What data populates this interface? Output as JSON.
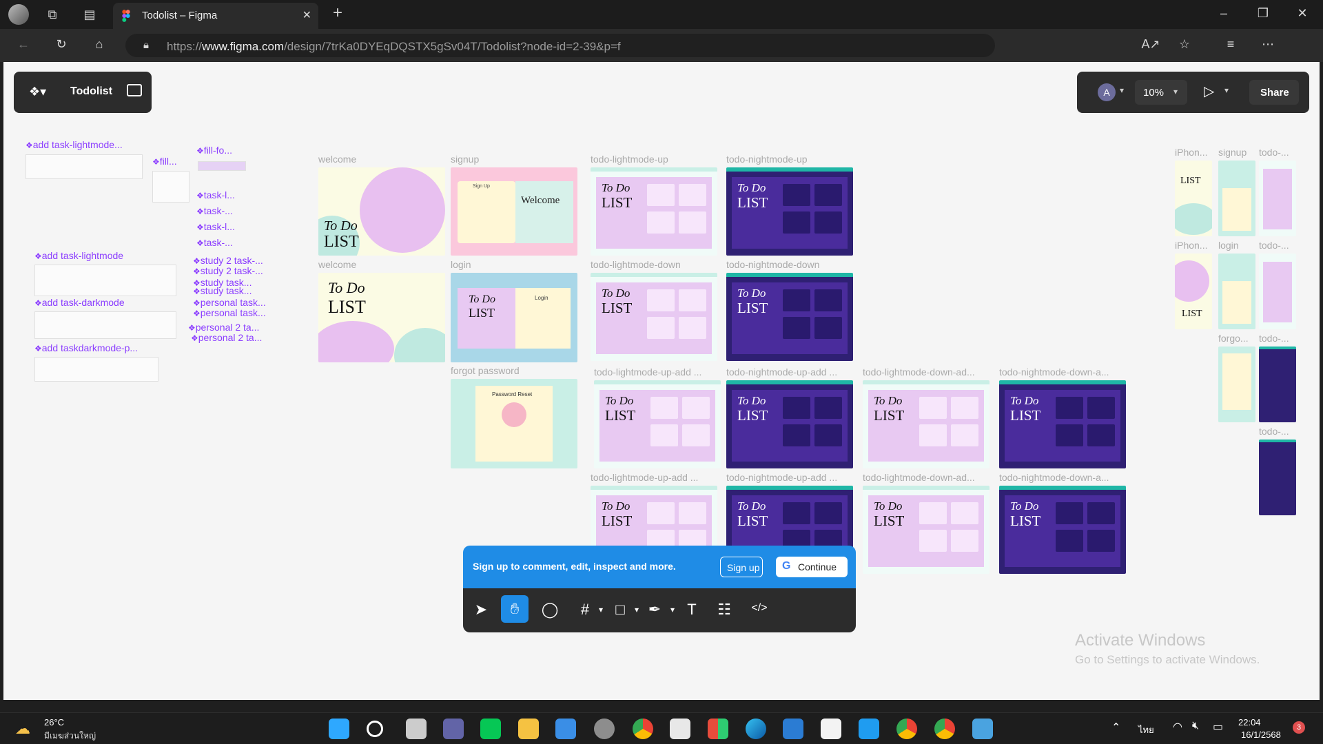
{
  "browser": {
    "tab_title": "Todolist – Figma",
    "url_prefix": "https://",
    "url_host": "www.figma.com",
    "url_path": "/design/7trKa0DYEqDQSTX5gSv04T/Todolist?node-id=2-39&p=f",
    "icons": {
      "back": "arrow-left-icon",
      "reload": "reload-icon",
      "home": "home-icon",
      "lock": "lock-icon",
      "read_aloud": "read-aloud-icon",
      "favorite": "star-icon",
      "favorites_list": "favorites-icon",
      "more": "more-icon",
      "copilot": "copilot-icon",
      "new_tab": "plus-icon"
    }
  },
  "figma": {
    "file_name": "Todolist",
    "avatar_letter": "A",
    "zoom": "10%",
    "share_label": "Share",
    "accent": "#1f8ce6"
  },
  "canvas": {
    "component_labels": [
      "add task-lightmode...",
      "fill...",
      "fill-fo...",
      "task-l...",
      "task-...",
      "task-l...",
      "task-...",
      "add task-lightmode",
      "study 2 task-...",
      "study 2 task-...",
      "study task...",
      "study task...",
      "add task-darkmode",
      "personal task...",
      "personal task...",
      "add taskdarkmode-p...",
      "personal 2 ta...",
      "personal 2 ta..."
    ],
    "frames": {
      "welcome": "welcome",
      "welcome2": "welcome",
      "signup": "signup",
      "login": "login",
      "forgot": "forgot password",
      "light_up": "todo-lightmode-up",
      "night_up": "todo-nightmode-up",
      "light_down": "todo-lightmode-down",
      "night_down": "todo-nightmode-down",
      "light_up_add": "todo-lightmode-up-add ...",
      "night_up_add": "todo-nightmode-up-add ...",
      "light_down_add": "todo-lightmode-down-ad...",
      "night_down_add": "todo-nightmode-down-a...",
      "light_up_add2": "todo-lightmode-up-add ...",
      "night_up_add2": "todo-nightmode-up-add ...",
      "light_down_add2": "todo-lightmode-down-ad...",
      "night_down_add2": "todo-nightmode-down-a...",
      "iphone1": "iPhon...",
      "iphone2": "iPhon...",
      "signup_m": "signup",
      "login_m": "login",
      "forgot_m": "forgo...",
      "todo_m1": "todo-...",
      "todo_m2": "todo-...",
      "todo_m3": "todo-...",
      "todo_m4": "todo-..."
    },
    "thumb_text": {
      "to_do": "To Do",
      "list": "LIST",
      "welcome": "Welcome",
      "sign_up": "Sign Up",
      "login": "Login",
      "password_reset": "Password Reset"
    }
  },
  "signup_banner": {
    "message": "Sign up to comment, edit, inspect and more.",
    "signup": "Sign up",
    "continue": "Continue"
  },
  "toolbar": {
    "icons": [
      "move-icon",
      "hand-icon",
      "comment-icon",
      "frame-icon",
      "rectangle-icon",
      "pen-icon",
      "text-icon",
      "components-icon",
      "dev-mode-icon"
    ]
  },
  "watermark": {
    "line1": "Activate Windows",
    "line2": "Go to Settings to activate Windows."
  },
  "taskbar": {
    "temperature": "26°C",
    "weather_text": "มีเมฆส่วนใหญ่",
    "language": "ไทย",
    "time": "22:04",
    "date": "16/1/2568",
    "notification_count": "3"
  }
}
